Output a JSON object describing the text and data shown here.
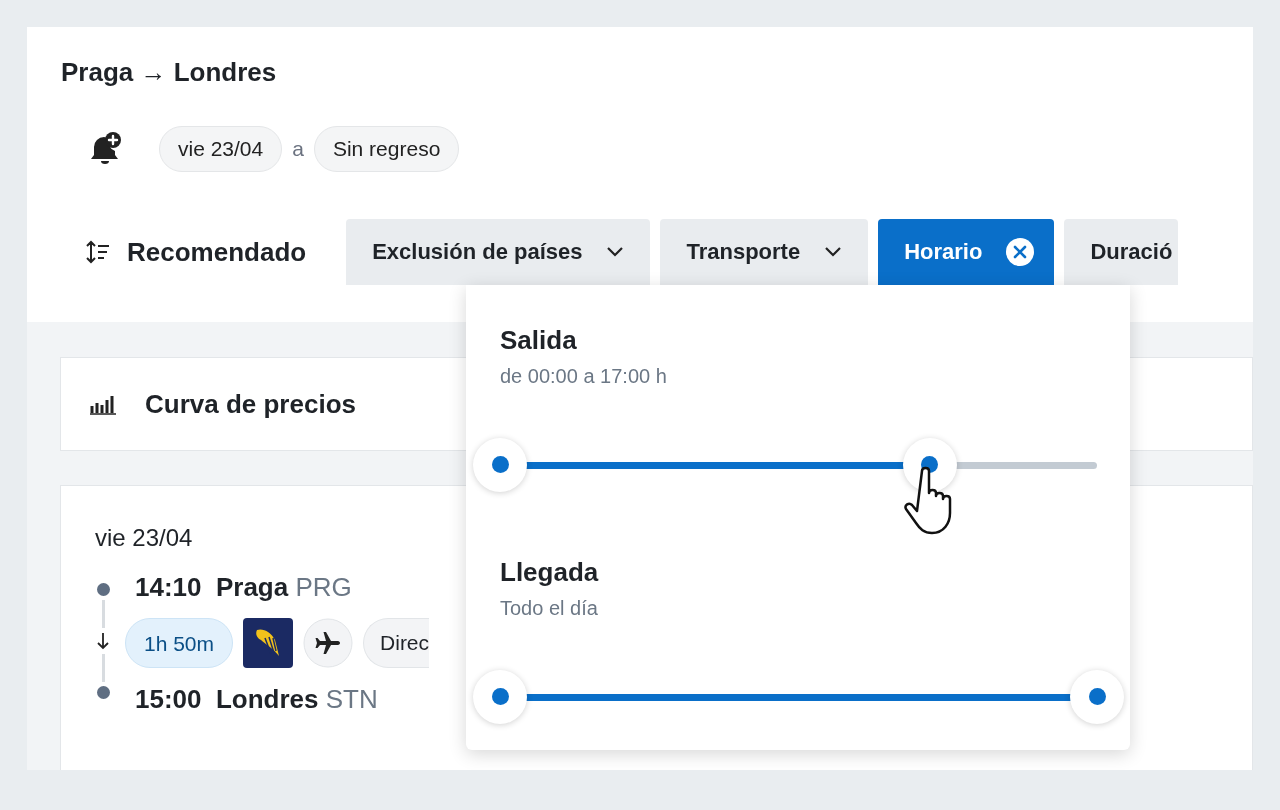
{
  "route": {
    "origin": "Praga",
    "arrow": "→",
    "destination": "Londres"
  },
  "dates": {
    "departure": "vie 23/04",
    "connector": "a",
    "return": "Sin regreso"
  },
  "sort": {
    "label": "Recomendado"
  },
  "filters": [
    {
      "label": "Exclusión de países",
      "selected": false,
      "kind": "dropdown"
    },
    {
      "label": "Transporte",
      "selected": false,
      "kind": "dropdown"
    },
    {
      "label": "Horario",
      "selected": true,
      "kind": "dropdown"
    },
    {
      "label": "Duració",
      "selected": false,
      "kind": "cut"
    }
  ],
  "price_curve": {
    "title": "Curva de precios"
  },
  "flight": {
    "date": "vie 23/04",
    "depart": {
      "time": "14:10",
      "city": "Praga",
      "code": "PRG"
    },
    "duration": "1h 50m",
    "stop_label": "Direc",
    "arrive": {
      "time": "15:00",
      "city": "Londres",
      "code": "STN"
    }
  },
  "time_popup": {
    "sections": [
      {
        "title": "Salida",
        "range": "de 00:00 a 17:00 h",
        "level": 0.72,
        "pointer": true
      },
      {
        "title": "Llegada",
        "range": "Todo el día",
        "level": 1,
        "pointer": false
      }
    ]
  }
}
